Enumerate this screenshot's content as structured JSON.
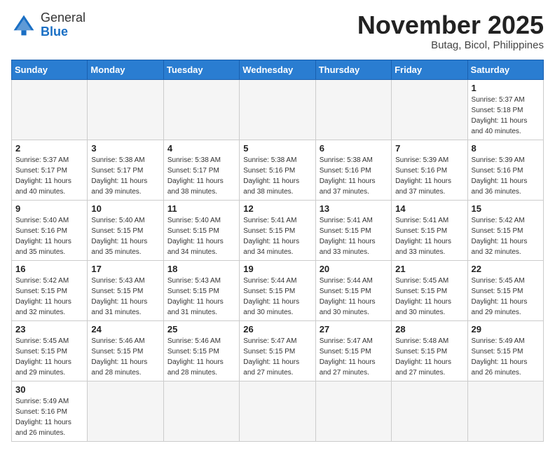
{
  "header": {
    "logo_general": "General",
    "logo_blue": "Blue",
    "month_title": "November 2025",
    "location": "Butag, Bicol, Philippines"
  },
  "weekdays": [
    "Sunday",
    "Monday",
    "Tuesday",
    "Wednesday",
    "Thursday",
    "Friday",
    "Saturday"
  ],
  "weeks": [
    [
      {
        "day": "",
        "info": ""
      },
      {
        "day": "",
        "info": ""
      },
      {
        "day": "",
        "info": ""
      },
      {
        "day": "",
        "info": ""
      },
      {
        "day": "",
        "info": ""
      },
      {
        "day": "",
        "info": ""
      },
      {
        "day": "1",
        "info": "Sunrise: 5:37 AM\nSunset: 5:18 PM\nDaylight: 11 hours\nand 40 minutes."
      }
    ],
    [
      {
        "day": "2",
        "info": "Sunrise: 5:37 AM\nSunset: 5:17 PM\nDaylight: 11 hours\nand 40 minutes."
      },
      {
        "day": "3",
        "info": "Sunrise: 5:38 AM\nSunset: 5:17 PM\nDaylight: 11 hours\nand 39 minutes."
      },
      {
        "day": "4",
        "info": "Sunrise: 5:38 AM\nSunset: 5:17 PM\nDaylight: 11 hours\nand 38 minutes."
      },
      {
        "day": "5",
        "info": "Sunrise: 5:38 AM\nSunset: 5:16 PM\nDaylight: 11 hours\nand 38 minutes."
      },
      {
        "day": "6",
        "info": "Sunrise: 5:38 AM\nSunset: 5:16 PM\nDaylight: 11 hours\nand 37 minutes."
      },
      {
        "day": "7",
        "info": "Sunrise: 5:39 AM\nSunset: 5:16 PM\nDaylight: 11 hours\nand 37 minutes."
      },
      {
        "day": "8",
        "info": "Sunrise: 5:39 AM\nSunset: 5:16 PM\nDaylight: 11 hours\nand 36 minutes."
      }
    ],
    [
      {
        "day": "9",
        "info": "Sunrise: 5:40 AM\nSunset: 5:16 PM\nDaylight: 11 hours\nand 35 minutes."
      },
      {
        "day": "10",
        "info": "Sunrise: 5:40 AM\nSunset: 5:15 PM\nDaylight: 11 hours\nand 35 minutes."
      },
      {
        "day": "11",
        "info": "Sunrise: 5:40 AM\nSunset: 5:15 PM\nDaylight: 11 hours\nand 34 minutes."
      },
      {
        "day": "12",
        "info": "Sunrise: 5:41 AM\nSunset: 5:15 PM\nDaylight: 11 hours\nand 34 minutes."
      },
      {
        "day": "13",
        "info": "Sunrise: 5:41 AM\nSunset: 5:15 PM\nDaylight: 11 hours\nand 33 minutes."
      },
      {
        "day": "14",
        "info": "Sunrise: 5:41 AM\nSunset: 5:15 PM\nDaylight: 11 hours\nand 33 minutes."
      },
      {
        "day": "15",
        "info": "Sunrise: 5:42 AM\nSunset: 5:15 PM\nDaylight: 11 hours\nand 32 minutes."
      }
    ],
    [
      {
        "day": "16",
        "info": "Sunrise: 5:42 AM\nSunset: 5:15 PM\nDaylight: 11 hours\nand 32 minutes."
      },
      {
        "day": "17",
        "info": "Sunrise: 5:43 AM\nSunset: 5:15 PM\nDaylight: 11 hours\nand 31 minutes."
      },
      {
        "day": "18",
        "info": "Sunrise: 5:43 AM\nSunset: 5:15 PM\nDaylight: 11 hours\nand 31 minutes."
      },
      {
        "day": "19",
        "info": "Sunrise: 5:44 AM\nSunset: 5:15 PM\nDaylight: 11 hours\nand 30 minutes."
      },
      {
        "day": "20",
        "info": "Sunrise: 5:44 AM\nSunset: 5:15 PM\nDaylight: 11 hours\nand 30 minutes."
      },
      {
        "day": "21",
        "info": "Sunrise: 5:45 AM\nSunset: 5:15 PM\nDaylight: 11 hours\nand 30 minutes."
      },
      {
        "day": "22",
        "info": "Sunrise: 5:45 AM\nSunset: 5:15 PM\nDaylight: 11 hours\nand 29 minutes."
      }
    ],
    [
      {
        "day": "23",
        "info": "Sunrise: 5:45 AM\nSunset: 5:15 PM\nDaylight: 11 hours\nand 29 minutes."
      },
      {
        "day": "24",
        "info": "Sunrise: 5:46 AM\nSunset: 5:15 PM\nDaylight: 11 hours\nand 28 minutes."
      },
      {
        "day": "25",
        "info": "Sunrise: 5:46 AM\nSunset: 5:15 PM\nDaylight: 11 hours\nand 28 minutes."
      },
      {
        "day": "26",
        "info": "Sunrise: 5:47 AM\nSunset: 5:15 PM\nDaylight: 11 hours\nand 27 minutes."
      },
      {
        "day": "27",
        "info": "Sunrise: 5:47 AM\nSunset: 5:15 PM\nDaylight: 11 hours\nand 27 minutes."
      },
      {
        "day": "28",
        "info": "Sunrise: 5:48 AM\nSunset: 5:15 PM\nDaylight: 11 hours\nand 27 minutes."
      },
      {
        "day": "29",
        "info": "Sunrise: 5:49 AM\nSunset: 5:15 PM\nDaylight: 11 hours\nand 26 minutes."
      }
    ],
    [
      {
        "day": "30",
        "info": "Sunrise: 5:49 AM\nSunset: 5:16 PM\nDaylight: 11 hours\nand 26 minutes."
      },
      {
        "day": "",
        "info": ""
      },
      {
        "day": "",
        "info": ""
      },
      {
        "day": "",
        "info": ""
      },
      {
        "day": "",
        "info": ""
      },
      {
        "day": "",
        "info": ""
      },
      {
        "day": "",
        "info": ""
      }
    ]
  ]
}
